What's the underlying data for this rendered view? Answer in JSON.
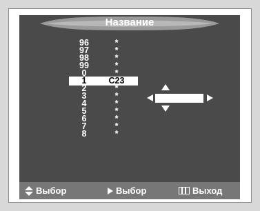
{
  "title": "Название",
  "channels": [
    {
      "num": "96",
      "name": "*"
    },
    {
      "num": "97",
      "name": "*"
    },
    {
      "num": "98",
      "name": "*"
    },
    {
      "num": "99",
      "name": "*"
    },
    {
      "num": "0",
      "name": "*"
    },
    {
      "num": "1",
      "name": "C23",
      "selected": true
    },
    {
      "num": "2",
      "name": "*"
    },
    {
      "num": "3",
      "name": "*"
    },
    {
      "num": "4",
      "name": "*"
    },
    {
      "num": "5",
      "name": "*"
    },
    {
      "num": "6",
      "name": "*"
    },
    {
      "num": "7",
      "name": "*"
    },
    {
      "num": "8",
      "name": "*"
    }
  ],
  "editor": {
    "value": ""
  },
  "footer": {
    "move_label": "Выбор",
    "select_label": "Выбор",
    "exit_label": "Выход"
  },
  "icons": {
    "move": "up-down-arrows-icon",
    "select": "play-right-icon",
    "exit": "menu-exit-icon"
  },
  "colors": {
    "osd_background": "#4a4a4a",
    "footer_background": "#777777",
    "text": "#ffffff",
    "selection": "#ffffff"
  }
}
